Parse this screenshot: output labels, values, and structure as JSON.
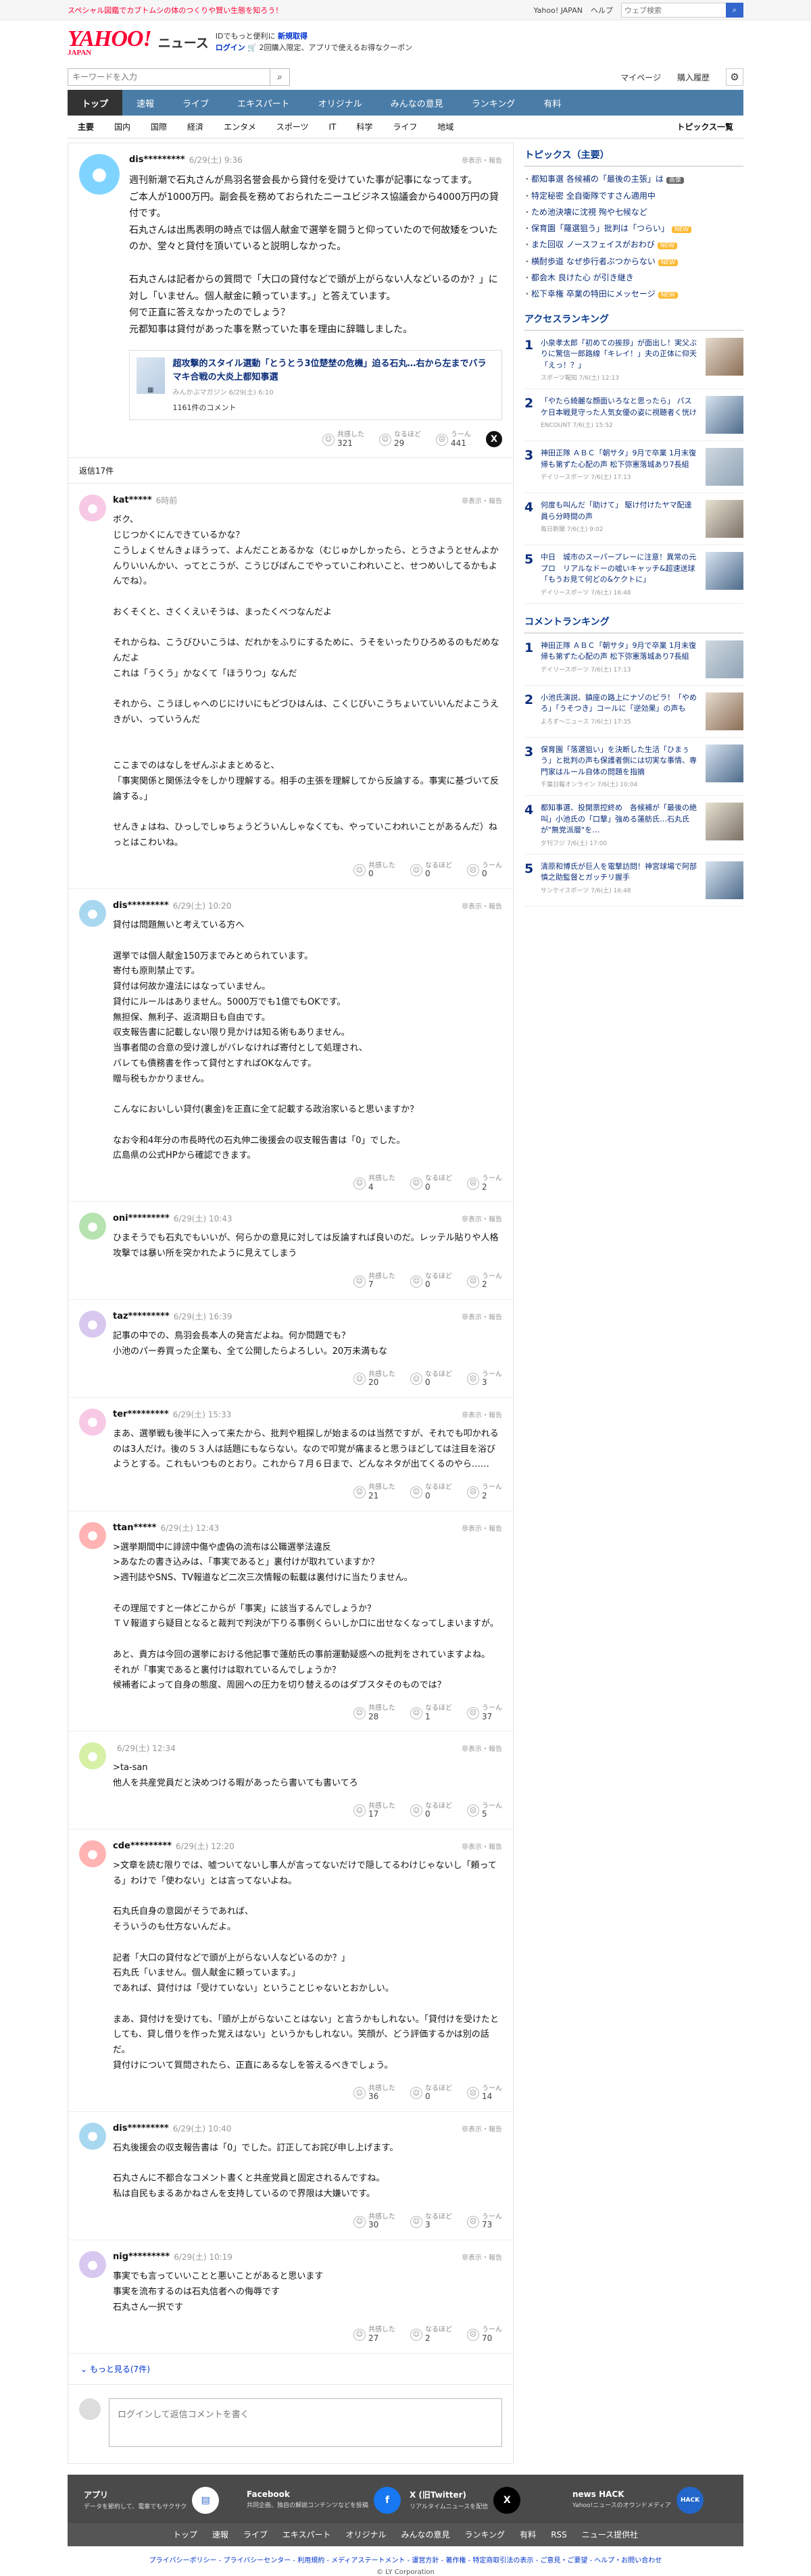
{
  "topbar": {
    "promo": "スペシャル図鑑でカブトムシの体のつくりや賢い生態を知ろう！",
    "yahoo": "Yahoo! JAPAN",
    "help": "ヘルプ",
    "search_placeholder": "ウェブ検索"
  },
  "header": {
    "logo": "YAHOO!",
    "logo_sub": "JAPAN",
    "service": "ニュース",
    "promo1": "IDでもっと便利に",
    "promo1b": "新規取得",
    "login": "ログイン",
    "promo2": "2回購入限定、アプリで使えるお得なクーポン"
  },
  "search": {
    "placeholder": "キーワードを入力",
    "mypage": "マイページ",
    "history": "購入履歴"
  },
  "nav": [
    "トップ",
    "速報",
    "ライブ",
    "エキスパート",
    "オリジナル",
    "みんなの意見",
    "ランキング",
    "有料"
  ],
  "subnav": {
    "items": [
      "主要",
      "国内",
      "国際",
      "経済",
      "エンタメ",
      "スポーツ",
      "IT",
      "科学",
      "ライフ",
      "地域"
    ],
    "list": "トピックス一覧"
  },
  "top_comment": {
    "user": "dis*********",
    "date": "6/29(土) 9:36",
    "report": "非表示・報告",
    "text": "週刊新潮で石丸さんが鳥羽名誉会長から貸付を受けていた事が記事になってます。\nご本人が1000万円。副会長を務めておられたニーユビジネス協議会から4000万円の貸付です。\n石丸さんは出馬表明の時点では個人献金で選挙を闘うと仰っていたので何故矮をついたのか、堂々と貸付を頂いていると説明しなかった。\n\n石丸さんは記者からの質問で「大口の貸付などで頭が上がらない人などいるのか？」に対し「いません。個人献金に頼っています。」と答えています。\n何で正直に答えなかったのでしょう？\n元都知事は貸付があった事を黙っていた事を理由に辞職しました。",
    "card": {
      "title": "超攻撃的スタイル選動「とうとう3位楚埜の危機」迫る石丸…右から左までバラマキ合戦の大炎上都知事選",
      "source": "みんかぶマガジン 6/29(土) 6:10",
      "comments": "1161件のコメント"
    },
    "reactions": [
      {
        "label": "共感した",
        "count": "321"
      },
      {
        "label": "なるほど",
        "count": "29"
      },
      {
        "label": "うーん",
        "count": "441"
      }
    ]
  },
  "replies_label": "返信17件",
  "replies": [
    {
      "user": "kat*****",
      "date": "6時前",
      "text": "ボク、\nじじつかくにんできているかな？\nこうしょくせんきょほうって、よんだことあるかな（むじゅかしかったら、とうさようとせんよかんりいいんかい、ってとこうが、こうじびばんこでやっていこわれいこと、せつめいしてるかもよんでね）。\n\nおくそくと、さくくえいそうは、まったくべつなんだよ\n\nそれからね、こうびひいこうは、だれかをふりにするために、うそをいったりひろめるのもだめなんだよ\nこれは「うくう」かなくて「ほうりつ」なんだ\n\nそれから、こうほしゃへのじにけいにもどづひはんは、こくじびいこうちょいていいんだよこうえきがい、っていうんだ\n\n\nここまでのはなしをぜんぶよまとめると、\n「事実関係と関係法令をしかり理解する。相手の主張を理解してから反論する。事実に基づいて反論する。」\n\nせんきょはね、ひっしでしゅちょうどういんしゃなくても、やっていこわれいことがあるんだ）ねっとはこわいね。",
      "c": [
        "0",
        "0",
        "0"
      ],
      "av": "pink"
    },
    {
      "user": "dis*********",
      "date": "6/29(土) 10:20",
      "text": "貸付は問題無いと考えている方へ\n\n選挙では個人献金150万までみとめられています。\n寄付も原則禁止です。\n貸付は何故か違法にはなっていません。\n貸付にルールはありません。5000万でも1億でもOKです。\n無担保、無利子、返済期日も自由です。\n収支報告書に記載しない限り見かけは知る術もありません。\n当事者間の合意の受け渡しがバレなければ寄付として処理され、\nバレても債務書を作って貸付とすればOKなんです。\n贈与税もかかりません。\n\nこんなにおいしい貸付(裏金)を正直に全て記載する政治家いると思いますか？\n\nなお令和4年分の市長時代の石丸伸二後援会の収支報告書は「0」でした。\n広島県の公式HPから確認できます。",
      "c": [
        "4",
        "0",
        "2"
      ],
      "av": "blue"
    },
    {
      "user": "oni*********",
      "date": "6/29(土) 10:43",
      "text": "ひまそうでも石丸でもいいが、何らかの意見に対しては反論すれば良いのだ。レッテル貼りや人格攻撃では暴い所を突かれたように見えてしまう",
      "c": [
        "7",
        "0",
        "2"
      ],
      "av": "green"
    },
    {
      "user": "taz*********",
      "date": "6/29(土) 16:39",
      "text": "記事の中での、鳥羽会長本人の発言だよね。何か問題でも？\n小池のパー券買った企業も、全て公開したらよろしい。20万未満もな",
      "c": [
        "20",
        "0",
        "3"
      ],
      "av": "purple"
    },
    {
      "user": "ter*********",
      "date": "6/29(土) 15:33",
      "text": "まあ、選挙戦も後半に入って来たから、批判や粗探しが始まるのは当然ですが、それでも叩かれるのは3人だけ。後の５３人は話題にもならない。なので叩覚が痛まると思うほどしては注目を浴びようとする。これもいつものとおり。これから７月６日まで、どんなネタが出てくるのやら……",
      "c": [
        "21",
        "0",
        "2"
      ],
      "av": "pink"
    },
    {
      "user": "ttan*****",
      "date": "6/29(土) 12:43",
      "text": ">選挙期間中に誹謗中傷や虚偽の流布は公職選挙法違反\n>あなたの書き込みは、「事実であると」裏付けが取れていますか？\n>週刊誌やSNS、TV報道など二次三次情報の転載は裏付けに当たりません。\n\nその理屈ですと一体どこからが「事実」に該当するんでしょうか？\nＴＶ報道すら疑目となると裁判で判決が下りる事例くらいしか口に出せなくなってしまいますが。\n\nあと、貴方は今回の選挙における他記事で蓮舫氏の事前運動疑惑への批判をされていますよね。\nそれが「事実であると裏付けは取れているんでしょうか？\n候補者によって自身の態度、周囲への圧力を切り替えるのはダブスタそのものでは？",
      "c": [
        "28",
        "1",
        "37"
      ],
      "av": "red"
    },
    {
      "user": "",
      "date": "6/29(土) 12:34",
      "text": ">ta-san\n他人を共産党員だと決めつける暇があったら書いても書いてろ",
      "c": [
        "17",
        "0",
        "5"
      ],
      "av": "lime"
    },
    {
      "user": "cde*********",
      "date": "6/29(土) 12:20",
      "text": ">文章を読む限りでは、嘘ついてないし事人が言ってないだけで隠してるわけじゃないし「頼ってる」わけで「使わない」とは言ってないよね。\n\n石丸氏自身の意図がそうであれば、\nそういうのも仕方ないんだよ。\n\n記者「大口の貸付などで頭が上がらない人などいるのか？」\n石丸氏「いません。個人献金に頼っています。」\nであれば、貸付けは「受けていない」ということじゃないとおかしい。\n\nまあ、貸付けを受けても、「頭が上がらないことはない」と言うかもしれない。「貸付けを受けたとしても、貸し借りを作った覚えはない」というかもしれない。笑顔が、どう評価するかは別の話だ。\n貸付けについて質問されたら、正直にあるなしを答えるべきでしょう。",
      "c": [
        "36",
        "0",
        "14"
      ],
      "av": "red"
    },
    {
      "user": "dis*********",
      "date": "6/29(土) 10:40",
      "text": "石丸後援会の収支報告書は「0」でした。訂正してお詫び申し上げます。\n\n石丸さんに不都合なコメント書くと共産党員と固定されるんですね。\n私は自民もまるあかねさんを支持しているので界限は大嫌いです。",
      "c": [
        "30",
        "3",
        "73"
      ],
      "av": "blue"
    },
    {
      "user": "nig*********",
      "date": "6/29(土) 10:19",
      "text": "事実でも言っていいことと悪いことがあると思います\n事実を流布するのは石丸信者への侮辱です\n石丸さん一択です",
      "c": [
        "27",
        "2",
        "70"
      ],
      "av": "purple"
    }
  ],
  "more": "もっと見る(7件)",
  "post_placeholder": "ログインして返信コメントを書く",
  "side": {
    "topics_title": "トピックス（主要）",
    "topics": [
      {
        "t": "都知事選 各候補の「最後の主張」は",
        "b": "画像",
        "k": "img"
      },
      {
        "t": "特定秘密 全自衛隊ですさん適用中",
        "b": "",
        "k": ""
      },
      {
        "t": "ため池決壊に沈視 殉や七候など",
        "b": "",
        "k": ""
      },
      {
        "t": "保育園「羅選狙う」批判は「つらい」",
        "b": "NEW",
        "k": "new"
      },
      {
        "t": "また回収 ノースフェイスがおわび",
        "b": "NEW",
        "k": "new"
      },
      {
        "t": "横酎歩道 なぜ歩行者ぶつからない",
        "b": "NEW",
        "k": "new"
      },
      {
        "t": "都会木 良けた心 が引き継き",
        "b": "",
        "k": ""
      },
      {
        "t": "松下幸権 卒業の特田にメッセージ",
        "b": "NEW",
        "k": "new"
      }
    ],
    "access_title": "アクセスランキング",
    "access": [
      {
        "t": "小泉孝太郎「初めての挨拶」が面出し！実父ぶりに驚信一郎路線「キレイ！」夫の正体に仰天「えっ！？」",
        "s": "スポーツ報知 7/6(土) 12:13",
        "i": "a"
      },
      {
        "t": "「やたら綺麗な顔面いろなと思ったら」 パスケ日本戦見守った人気女優の姿に視聴者く恍け",
        "s": "ENCOUNT 7/6(土) 15:52",
        "i": "b"
      },
      {
        "t": "神田正隊 ＡＢＣ「朝サタ」9月で卒業 1月末復帰も第ずた心配の声 松下弥憲落城あり7長組",
        "s": "デイリースポーツ 7/6(土) 17:13",
        "i": ""
      },
      {
        "t": "何度も叫んだ「助けて」 駆け付けたヤマ配達員ら分時間の声",
        "s": "毎日新聞 7/6(土) 9:02",
        "i": "c"
      },
      {
        "t": "中日　城市のスーパープレーに注意！異常の元プロ　リアルなドーの嘘いキャッチ&超速送球「もうお見て何どの&ケクトに」",
        "s": "デイリースポーツ 7/6(土) 16:48",
        "i": "b"
      }
    ],
    "cr_title": "コメントランキング",
    "cr": [
      {
        "t": "神田正隊 ＡＢＣ「朝サタ」9月で卒業 1月末復帰も第ずた心配の声 松下弥憲落城あり7長組",
        "s": "デイリースポーツ 7/6(土) 17:13",
        "i": ""
      },
      {
        "t": "小池氏演説、鎮座の路上にナゾのビラ！「やめろ」「うそつき」コールに「逆効果」の声も",
        "s": "よろず〜ニュース 7/6(土) 17:35",
        "i": "a"
      },
      {
        "t": "保育園「落選狙い」を決断した生活「ひまぅう」と批判の声も保護者側には切実な事情、専門家はルール自体の問題を指摘",
        "s": "千葉日報オンライン 7/6(土) 10:04",
        "i": "b"
      },
      {
        "t": "都知事選、投開票控終め　各候補が「最後の絶叫」小池氏の「口撃」強める蓮舫氏…石丸氏が\"無党派層\"を…",
        "s": "夕刊フジ 7/6(土) 17:00",
        "i": "c"
      },
      {
        "t": "清原和博氏が巨人を電撃訪問！神宮球場で阿部慎之助監督とガッチリ握手",
        "s": "サンケイスポーツ 7/6(土) 16:48",
        "i": "b"
      }
    ]
  },
  "footer": {
    "apps": [
      {
        "n": "アプリ",
        "d": "データを節約して、電車でもサクサク",
        "i": "▤"
      },
      {
        "n": "Facebook",
        "d": "共同企画、独自の解説コンテンツなどを投稿",
        "i": "f"
      },
      {
        "n": "X (旧Twitter)",
        "d": "リアルタイムニュースを配信",
        "i": "X"
      },
      {
        "n": "news HACK",
        "d": "Yahoo!ニュースのオウンドメディア",
        "i": "HACK"
      }
    ],
    "nav": [
      "トップ",
      "速報",
      "ライブ",
      "エキスパート",
      "オリジナル",
      "みんなの意見",
      "ランキング",
      "有料",
      "RSS",
      "ニュース提供社"
    ],
    "links": "プライバシーポリシー - プライバシーセンター - 利用規約 - メディアステートメント - 運営方針 - 著作権 - 特定商取引法の表示 - ご意見・ご要望 - ヘルプ・お問い合わせ",
    "copy": "© LY Corporation"
  },
  "colors": {
    "brand": "#ff0033",
    "nav": "#4a7ca8",
    "link": "#0b2d7a"
  }
}
